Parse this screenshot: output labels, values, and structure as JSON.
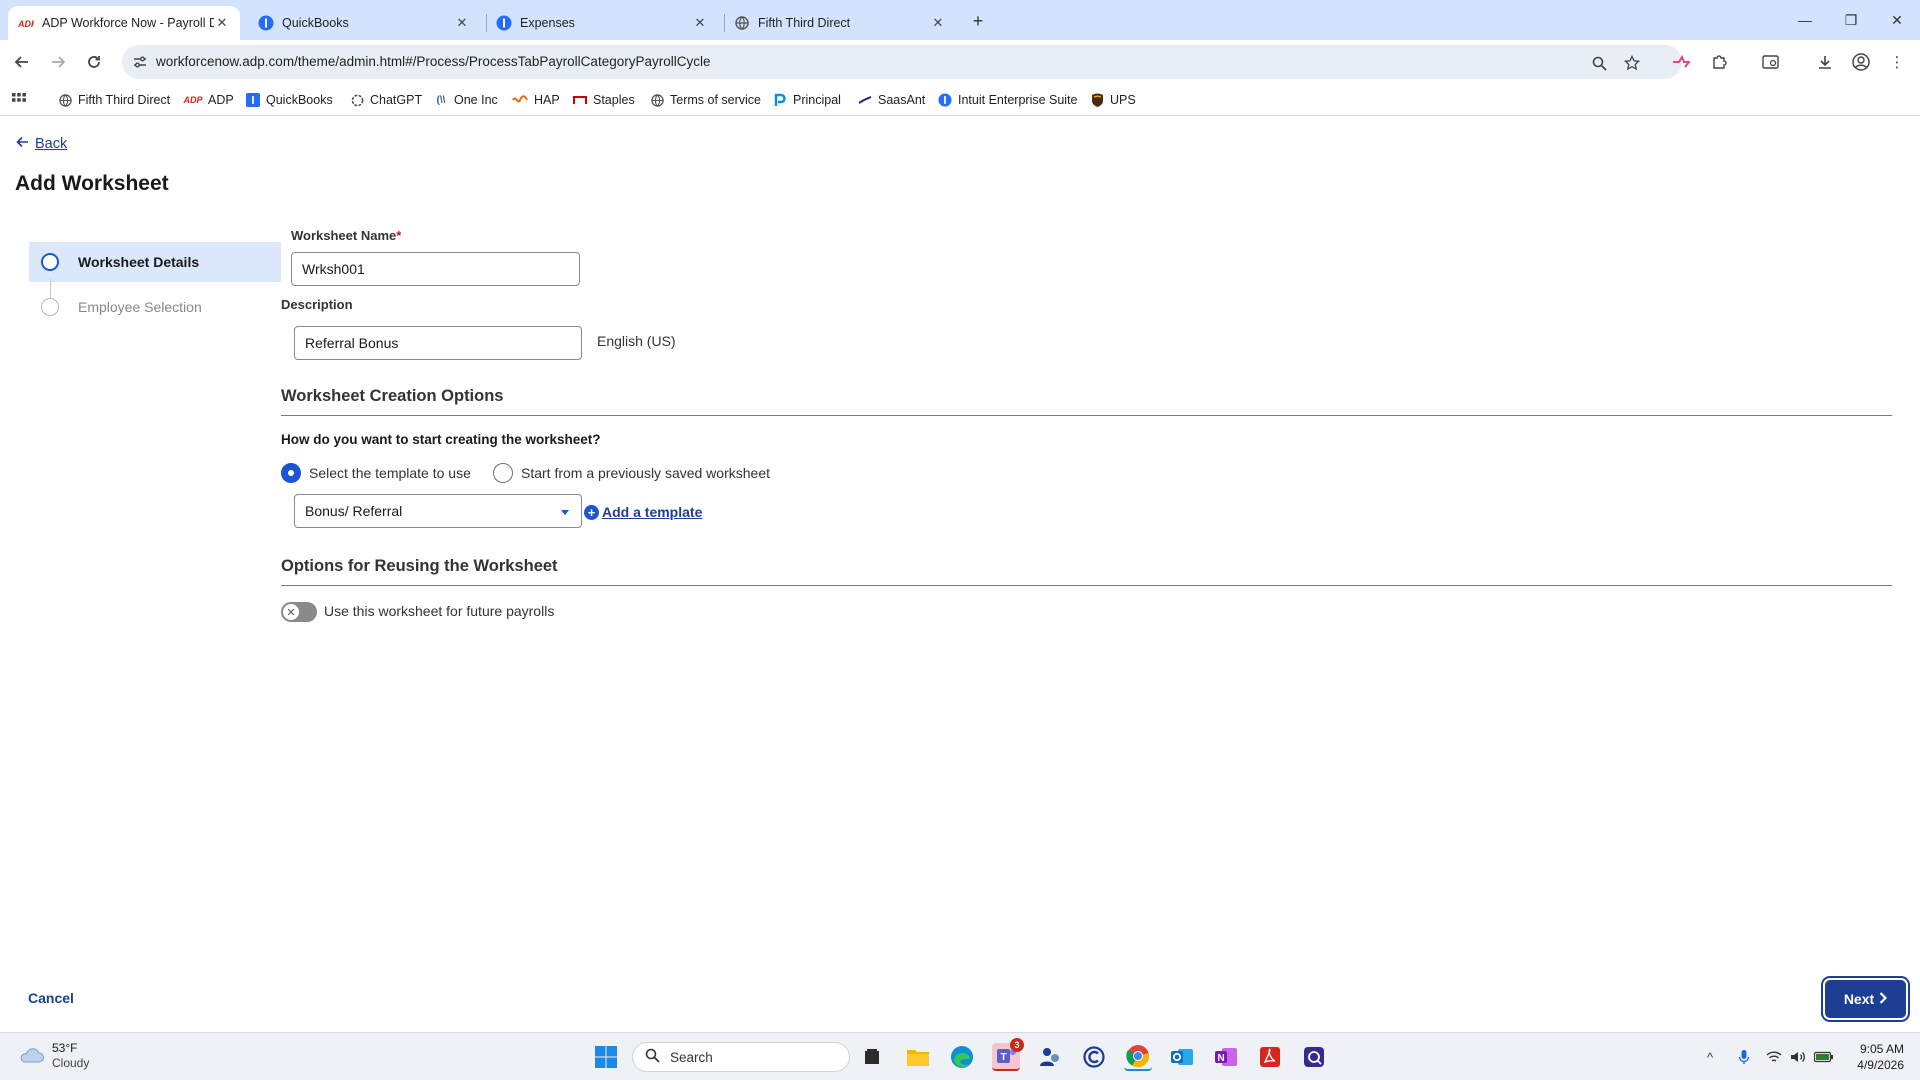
{
  "browser": {
    "tabs": [
      {
        "title": "ADP Workforce Now - Payroll D",
        "active": true
      },
      {
        "title": "QuickBooks",
        "active": false
      },
      {
        "title": "Expenses",
        "active": false
      },
      {
        "title": "Fifth Third Direct",
        "active": false
      }
    ],
    "url": "workforcenow.adp.com/theme/admin.html#/Process/ProcessTabPayrollCategoryPayrollCycle",
    "bookmarks": [
      "Fifth Third Direct",
      "ADP",
      "QuickBooks",
      "ChatGPT",
      "One Inc",
      "HAP",
      "Staples",
      "Terms of service",
      "Principal",
      "SaasAnt",
      "Intuit Enterprise Suite",
      "UPS"
    ]
  },
  "page": {
    "back_label": "Back",
    "title": "Add Worksheet",
    "steps": [
      {
        "label": "Worksheet Details",
        "active": true
      },
      {
        "label": "Employee Selection",
        "active": false
      }
    ],
    "worksheet_name_label": "Worksheet Name",
    "worksheet_name_required": "*",
    "worksheet_name_value": "Wrksh001",
    "description_label": "Description",
    "description_value": "Referral Bonus",
    "language": "English (US)",
    "creation_section_title": "Worksheet Creation Options",
    "creation_question": "How do you want to start creating the worksheet?",
    "option_template": "Select the template to use",
    "option_saved": "Start from a previously saved worksheet",
    "selected_option": "template",
    "template_value": "Bonus/ Referral",
    "add_template_label": "Add a template",
    "reuse_section_title": "Options for Reusing the Worksheet",
    "reuse_toggle_label": "Use this worksheet for future payrolls",
    "reuse_toggle_on": false,
    "cancel_label": "Cancel",
    "next_label": "Next"
  },
  "taskbar": {
    "temperature": "53°F",
    "condition": "Cloudy",
    "search_placeholder": "Search",
    "teams_badge": "3",
    "time": "9:05 AM",
    "date": "4/9/2026"
  },
  "colors": {
    "accent": "#1c3f94",
    "radio_selected": "#1c55d4",
    "step_active_bg": "#dbe7fb",
    "required": "#c8102e",
    "tabstrip": "#d3e3fd"
  }
}
